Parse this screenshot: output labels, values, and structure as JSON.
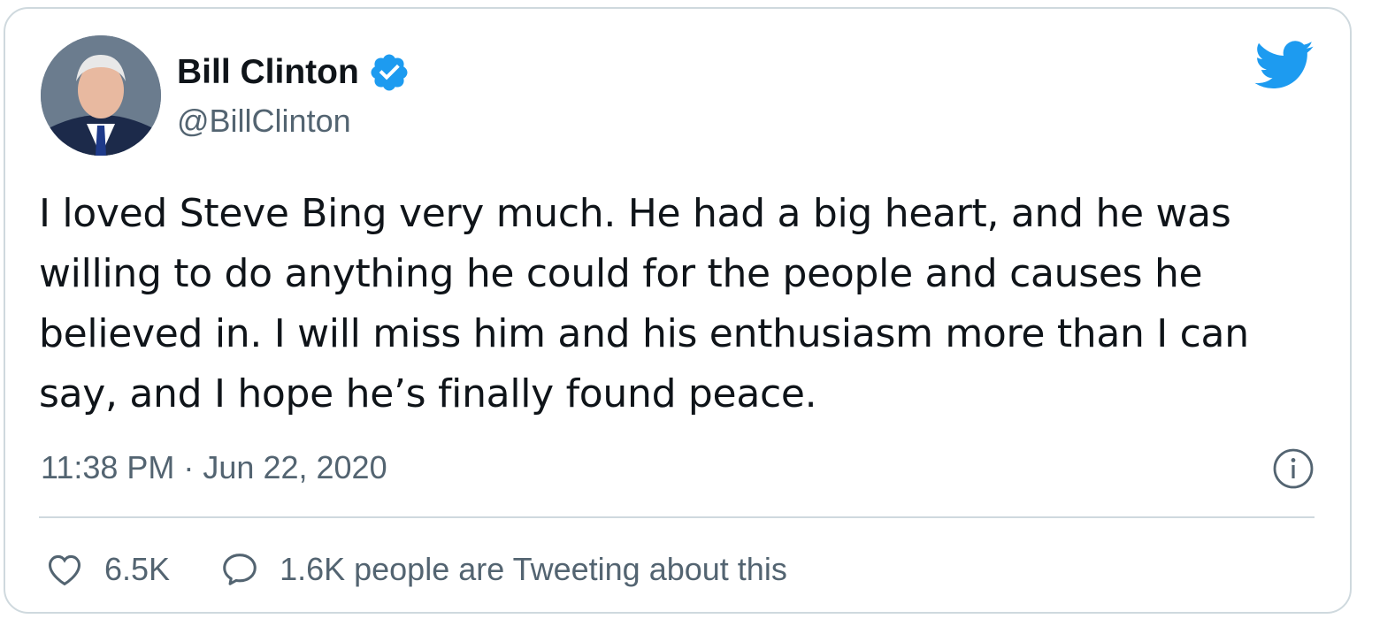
{
  "author": {
    "display_name": "Bill Clinton",
    "handle": "@BillClinton",
    "verified": true,
    "avatar_icon": "avatar-portrait"
  },
  "tweet": {
    "text": "I loved Steve Bing very much. He had a big heart, and he was willing to do anything he could for the people and causes he believed in. I will miss him and his enthusiasm more than I can say, and I hope he’s finally found peace.",
    "timestamp": "11:38 PM · Jun 22, 2020"
  },
  "actions": {
    "like_count": "6.5K",
    "conversation_text": "1.6K people are Tweeting about this"
  },
  "icons": {
    "brand": "twitter-bird-icon",
    "verified": "verified-badge-icon",
    "info": "info-icon",
    "like": "heart-icon",
    "reply": "speech-bubble-icon"
  },
  "colors": {
    "brand_blue": "#1d9bf0",
    "text_primary": "#0f1419",
    "text_secondary": "#536471",
    "border": "#cfd9de"
  }
}
